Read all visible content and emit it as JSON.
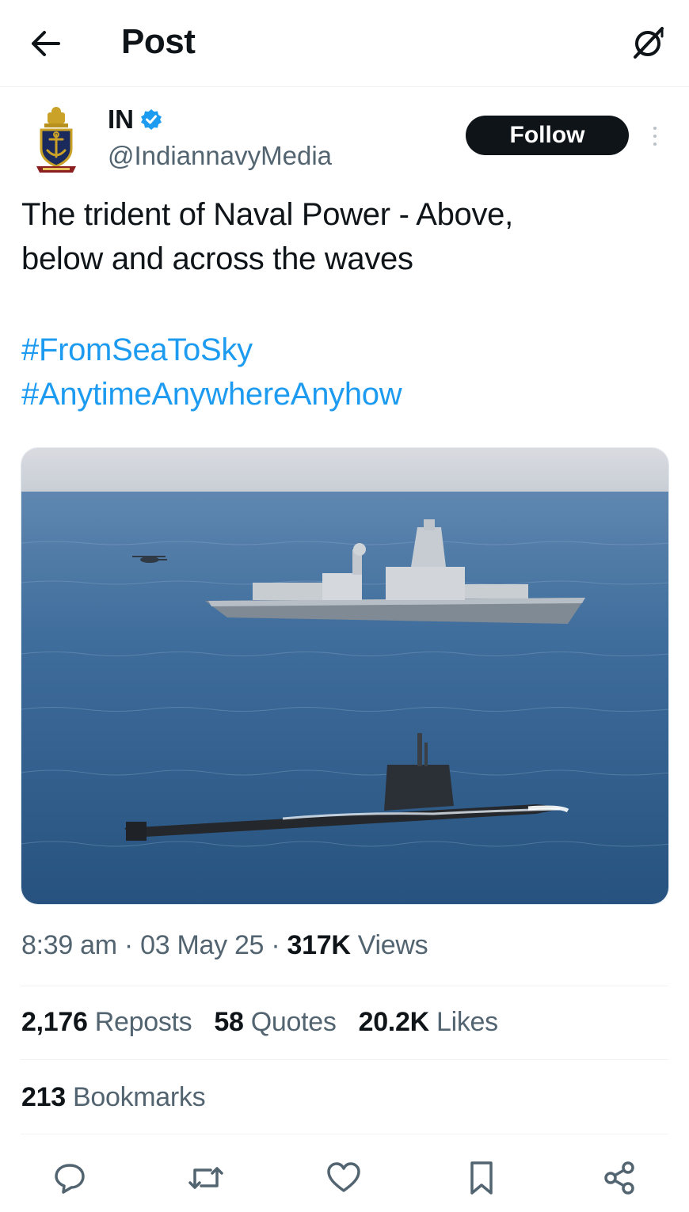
{
  "header": {
    "title": "Post",
    "back_icon": "arrow-left-icon",
    "grok_icon": "grok-icon"
  },
  "author": {
    "display_name": "IN",
    "handle": "@IndiannavyMedia",
    "verified": true,
    "verified_color": "#1d9bf0",
    "avatar_icon": "indian-navy-crest-icon"
  },
  "follow_label": "Follow",
  "tweet": {
    "text_line1": "The trident of Naval Power - Above,",
    "text_line2": "below and across the waves",
    "hashtags": [
      "#FromSeaToSky",
      "#AnytimeAnywhereAnyhow"
    ]
  },
  "media": {
    "description_icon": "ship-and-submarine-photo"
  },
  "meta": {
    "time": "8:39 am",
    "date": "03 May 25",
    "views_count": "317K",
    "views_label": "Views",
    "separator": "·"
  },
  "stats": {
    "reposts_count": "2,176",
    "reposts_label": "Reposts",
    "quotes_count": "58",
    "quotes_label": "Quotes",
    "likes_count": "20.2K",
    "likes_label": "Likes",
    "bookmarks_count": "213",
    "bookmarks_label": "Bookmarks"
  },
  "actions": [
    "reply-icon",
    "repost-icon",
    "like-icon",
    "bookmark-icon",
    "share-icon"
  ],
  "colors": {
    "link": "#1d9bf0",
    "text": "#0f1419",
    "secondary": "#536471",
    "divider": "#eff3f4"
  }
}
